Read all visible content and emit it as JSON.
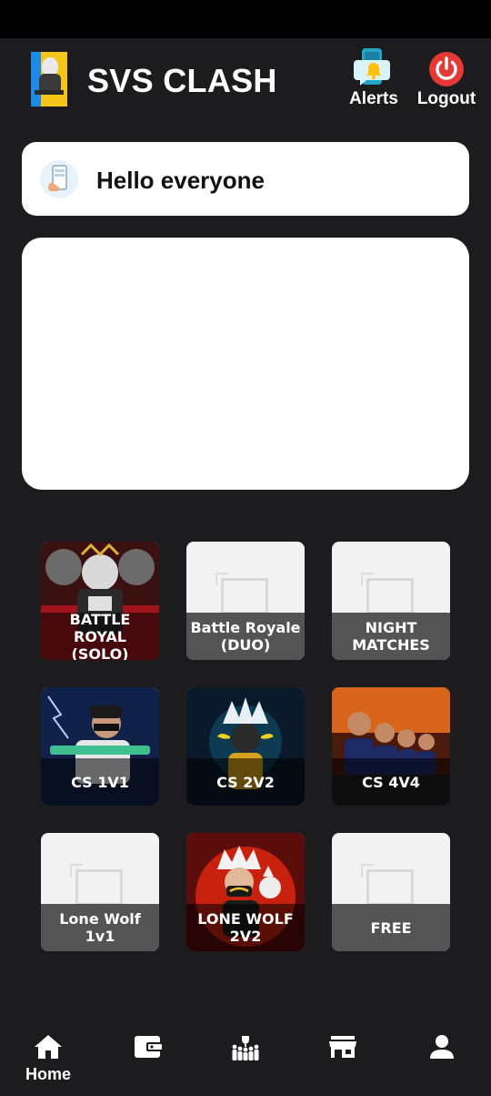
{
  "header": {
    "app_title": "SVS CLASH",
    "logo_icon": "svs-logo-icon",
    "alerts_label": "Alerts",
    "logout_label": "Logout",
    "alerts_icon": "bell-chat-icon",
    "logout_icon": "power-icon"
  },
  "notice": {
    "text": "Hello everyone",
    "icon": "phone-hand-icon"
  },
  "games": [
    {
      "label": "BATTLE ROYAL (SOLO)",
      "has_art": true
    },
    {
      "label": "Battle Royale (DUO)",
      "has_art": false
    },
    {
      "label": "NIGHT MATCHES",
      "has_art": false
    },
    {
      "label": "CS 1V1",
      "has_art": true
    },
    {
      "label": "CS 2V2",
      "has_art": true
    },
    {
      "label": "CS 4V4",
      "has_art": true
    },
    {
      "label": "Lone Wolf 1v1",
      "has_art": false
    },
    {
      "label": "LONE WOLF 2V2",
      "has_art": true
    },
    {
      "label": "FREE",
      "has_art": false
    }
  ],
  "bottom_nav": {
    "items": [
      {
        "label": "Home",
        "icon": "home-icon",
        "active": true
      },
      {
        "label": "",
        "icon": "wallet-icon"
      },
      {
        "label": "",
        "icon": "trophy-team-icon"
      },
      {
        "label": "",
        "icon": "store-icon"
      },
      {
        "label": "",
        "icon": "profile-icon"
      }
    ]
  },
  "colors": {
    "background": "#1c1c1e",
    "card": "#ffffff",
    "logout_red": "#e53935",
    "alerts_teal": "#26a5c9",
    "bell_yellow": "#ffc107"
  }
}
